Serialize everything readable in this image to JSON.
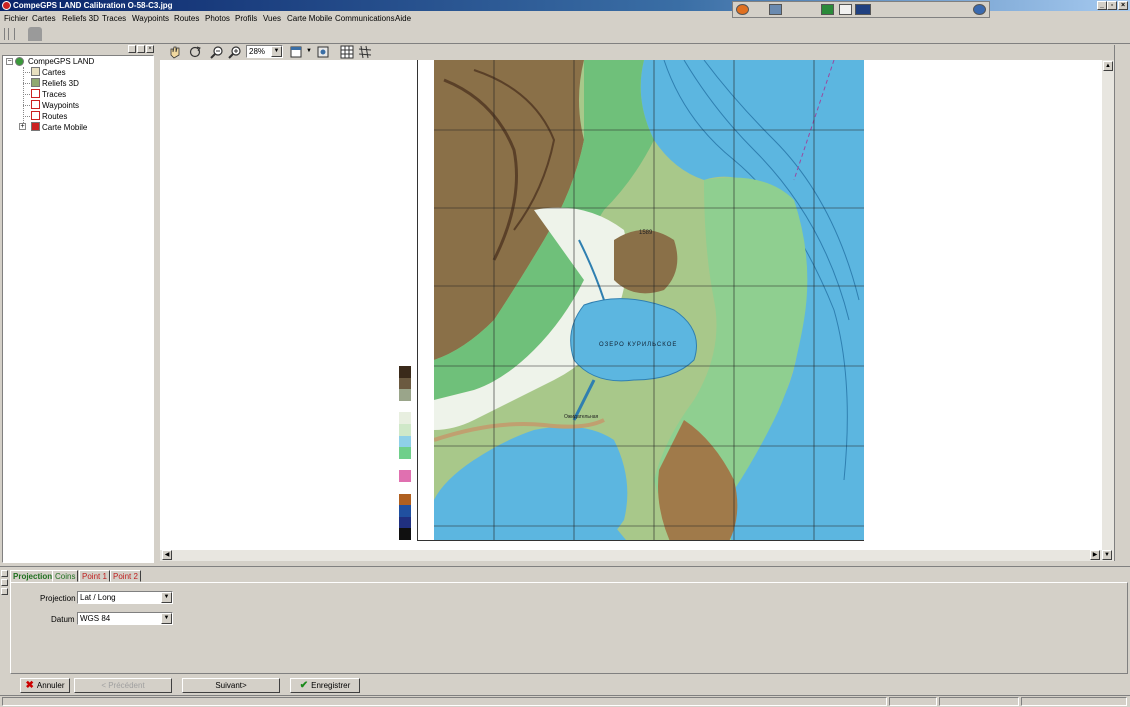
{
  "window": {
    "title": "CompeGPS LAND Calibration O-58-C3.jpg"
  },
  "menu": [
    "Fichier",
    "Cartes",
    "Reliefs 3D",
    "Traces",
    "Waypoints",
    "Routes",
    "Photos",
    "Profils",
    "Vues",
    "Carte Mobile",
    "Communications",
    "Aide"
  ],
  "toolbar": {
    "zoom_value": "28%"
  },
  "tree": {
    "root": "CompeGPS LAND",
    "items": [
      "Cartes",
      "Reliefs 3D",
      "Traces",
      "Waypoints",
      "Routes",
      "Carte Mobile"
    ]
  },
  "map": {
    "labels": {
      "lake": "ОЗЕРО КУРИЛЬСКОЕ",
      "peak": "1589",
      "settlement": "Ожидательная"
    },
    "legend_colors": [
      "#3a2a1a",
      "#6b5a40",
      "#9aa58a",
      "#ffffff",
      "#e8efe0",
      "#cfe8c8",
      "#8fd0e8",
      "#6fcf8a",
      "#ffffff",
      "#e070b0",
      "#ffffff",
      "#b06020",
      "#2050a0",
      "#203080",
      "#101010"
    ]
  },
  "bottom": {
    "tabs": [
      "Projection",
      "Coins",
      "Point 1",
      "Point 2"
    ],
    "projection_label": "Projection",
    "projection_value": "Lat / Long",
    "datum_label": "Datum",
    "datum_value": "WGS 84"
  },
  "buttons": {
    "cancel": "Annuler",
    "previous": "< Précédent",
    "next": "Suivant>",
    "save": "Enregistrer"
  }
}
